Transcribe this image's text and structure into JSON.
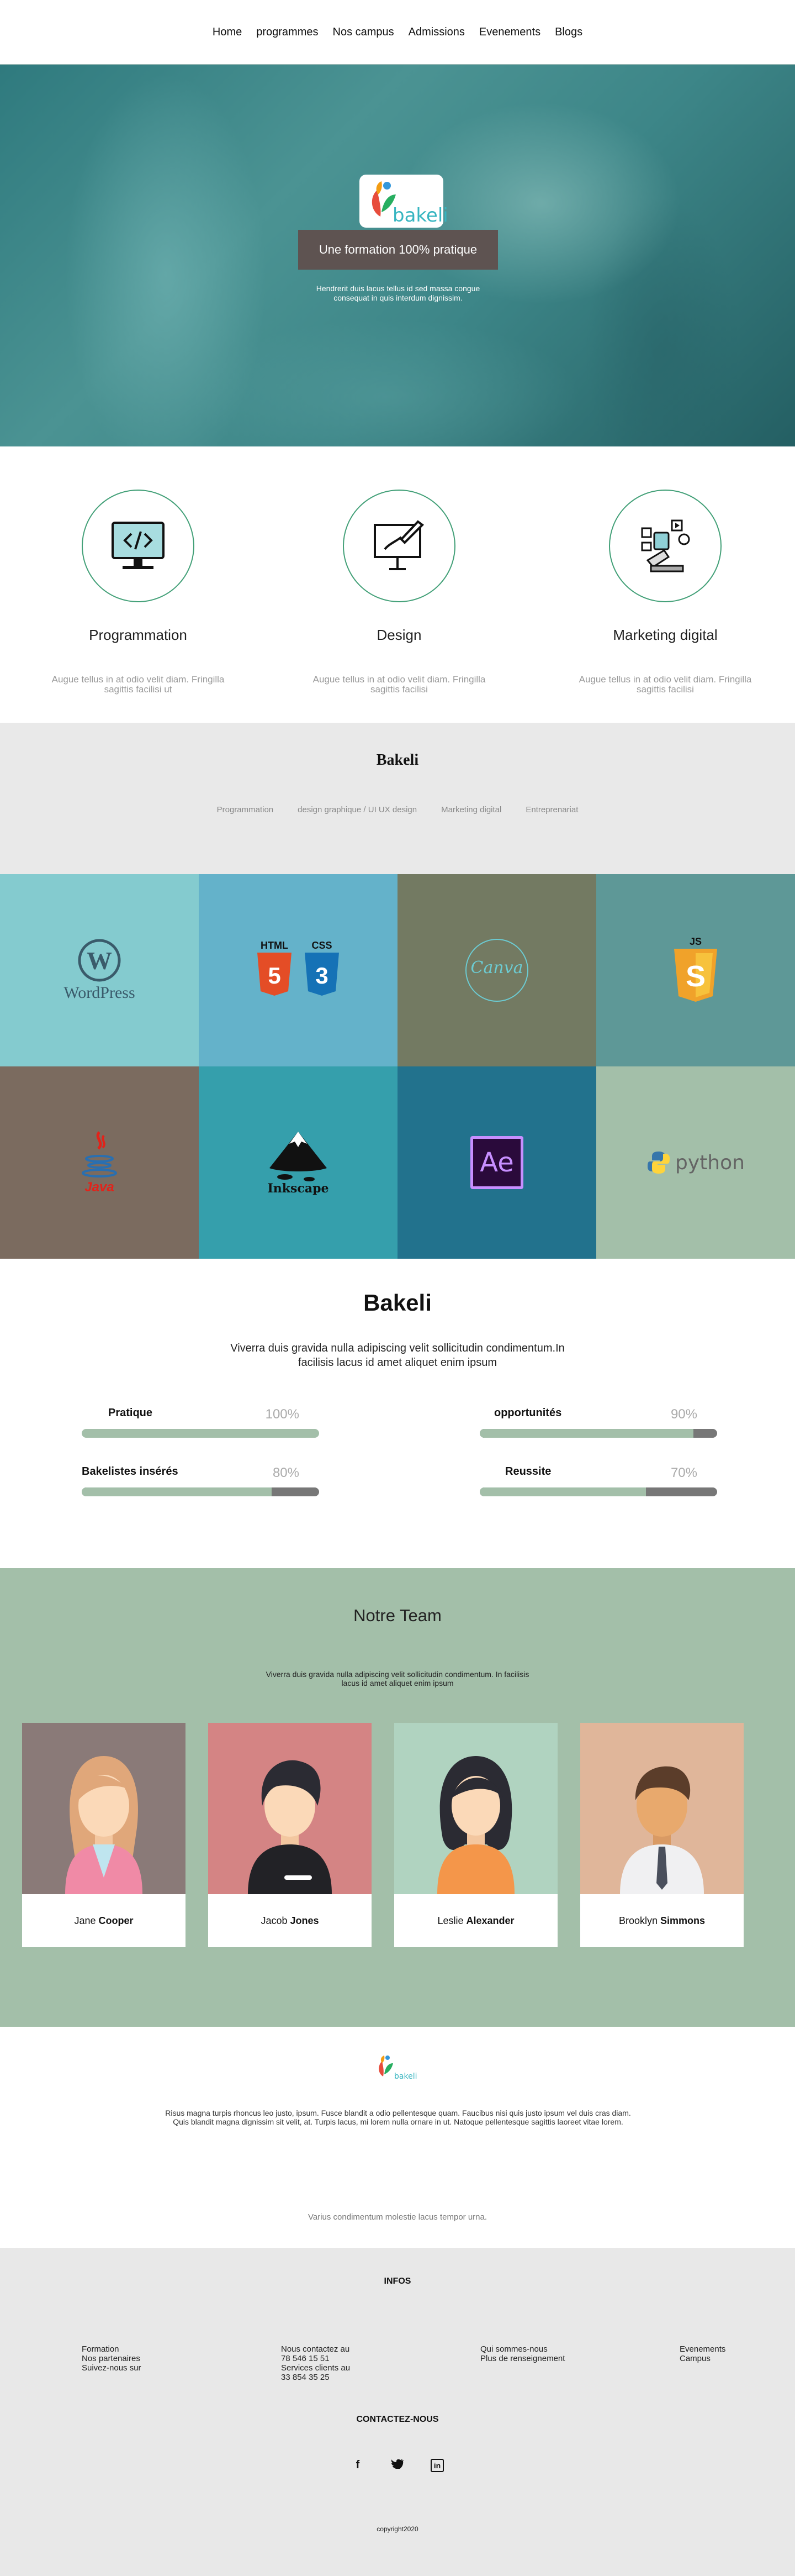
{
  "nav": {
    "items": [
      "Home",
      "programmes",
      "Nos campus",
      "Admissions",
      "Evenements",
      "Blogs"
    ]
  },
  "hero": {
    "logo_text": "bakeli",
    "badge": "Une formation 100% pratique",
    "subtitle": "Hendrerit duis lacus tellus id sed massa congue consequat in quis interdum dignissim."
  },
  "services": [
    {
      "title": "Programmation",
      "text": "Augue tellus in at odio velit diam. Fringilla sagittis facilisi ut",
      "icon": "monitor-code-icon"
    },
    {
      "title": "Design",
      "text": "Augue tellus in at odio velit diam. Fringilla sagittis facilisi",
      "icon": "easel-brush-icon"
    },
    {
      "title": "Marketing digital",
      "text": "Augue tellus in at odio velit diam. Fringilla sagittis facilisi",
      "icon": "marketing-icon"
    }
  ],
  "tabs_section": {
    "title": "Bakeli",
    "tabs": [
      "Programmation",
      "design graphique / UI UX design",
      "Marketing digital",
      "Entreprenariat"
    ]
  },
  "grid": {
    "tiles": [
      {
        "name": "wordpress",
        "label": "WordPress",
        "color": "#84cbcf"
      },
      {
        "name": "html-css",
        "label_a": "HTML",
        "label_b": "CSS",
        "color": "#64b2ca"
      },
      {
        "name": "canva",
        "label": "Canva",
        "color": "#737a62"
      },
      {
        "name": "javascript",
        "label": "JS",
        "color": "#5e9897"
      },
      {
        "name": "java",
        "label": "Java",
        "color": "#7b6b5f"
      },
      {
        "name": "inkscape",
        "label": "Inkscape",
        "color": "#359fac"
      },
      {
        "name": "after-effects",
        "label": "Ae",
        "color": "#22728d"
      },
      {
        "name": "python",
        "label": "python",
        "color": "#a3bfa9"
      }
    ]
  },
  "stats": {
    "title": "Bakeli",
    "lead": "Viverra duis gravida nulla adipiscing velit sollicitudin condimentum.In facilisis lacus id amet aliquet enim ipsum",
    "bars": [
      {
        "label": "Pratique",
        "percent": "100%",
        "value": 100
      },
      {
        "label": "opportunités",
        "percent": "90%",
        "value": 90
      },
      {
        "label": "Bakelistes insérés",
        "percent": "80%",
        "value": 80
      },
      {
        "label": "Reussite",
        "percent": "70%",
        "value": 70
      }
    ]
  },
  "team": {
    "title": "Notre Team",
    "lead": "Viverra duis gravida nulla adipiscing velit sollicitudin condimentum. In facilisis lacus id amet aliquet enim ipsum",
    "members": [
      {
        "first": "Jane",
        "last": "Cooper"
      },
      {
        "first": "Jacob",
        "last": "Jones"
      },
      {
        "first": "Leslie",
        "last": "Alexander"
      },
      {
        "first": "Brooklyn",
        "last": "Simmons"
      }
    ]
  },
  "about": {
    "logo_text": "bakeli",
    "text": "Risus magna turpis rhoncus leo justo, ipsum. Fusce blandit a odio pellentesque quam. Faucibus nisi quis justo ipsum vel duis cras diam. Quis blandit magna dignissim sit velit, at. Turpis lacus, mi lorem nulla ornare in ut. Natoque pellentesque sagittis laoreet vitae lorem.",
    "small": "Varius condimentum molestie lacus tempor urna."
  },
  "footer": {
    "infos_title": "INFOS",
    "col1": [
      "Formation",
      "Nos partenaires",
      "Suivez-nous sur"
    ],
    "col2": [
      "Nous contactez au",
      "78 546 15 51",
      "Services clients au",
      "33 854 35 25"
    ],
    "col3": [
      "Qui sommes-nous",
      "Plus de renseignement"
    ],
    "col4": [
      "Evenements",
      "Campus"
    ],
    "contact_title": "CONTACTEZ-NOUS",
    "social": [
      {
        "icon": "facebook-icon",
        "glyph": "f"
      },
      {
        "icon": "twitter-icon",
        "glyph": "🐦"
      },
      {
        "icon": "linkedin-icon",
        "glyph": "in"
      }
    ],
    "copyright": "copyright2020"
  }
}
